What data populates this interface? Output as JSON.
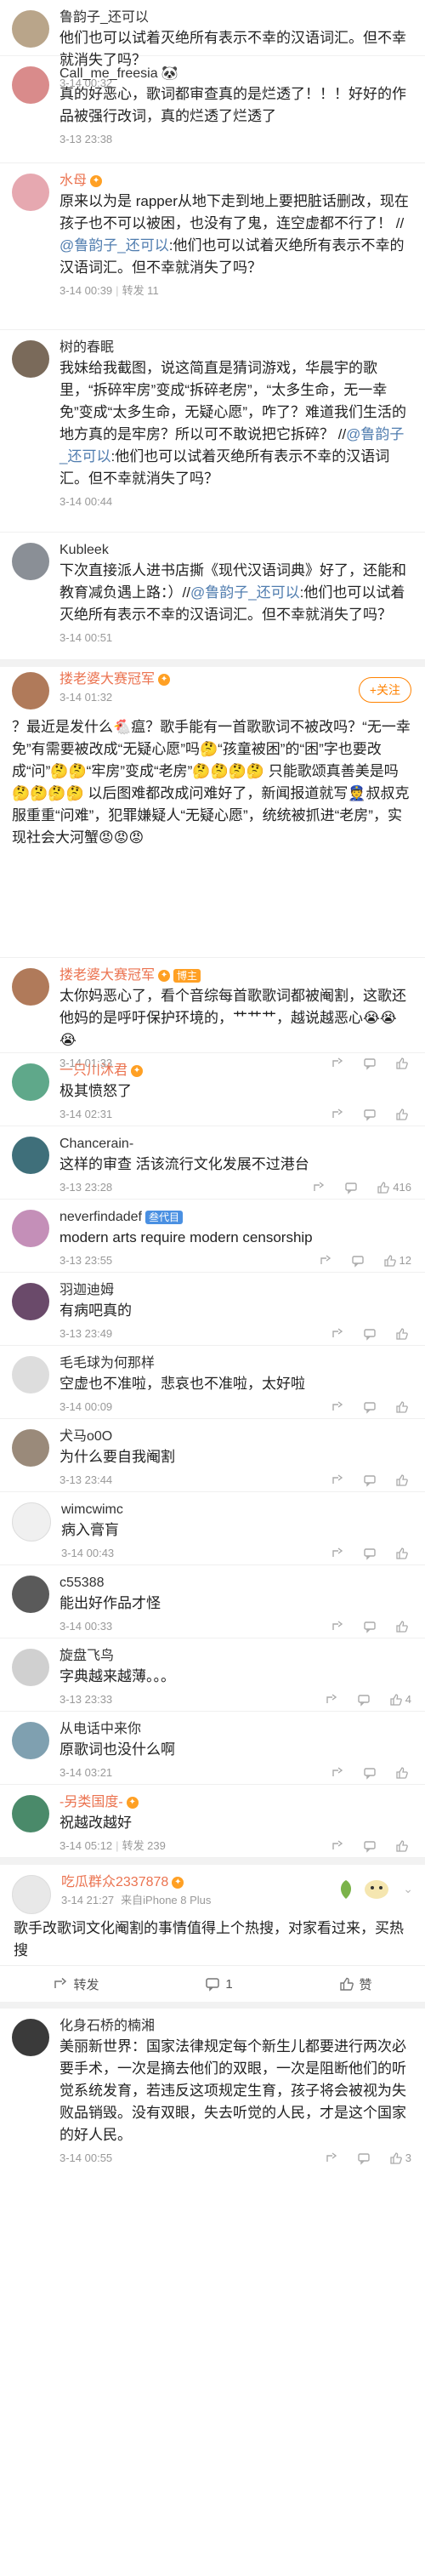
{
  "comments": [
    {
      "name": "鲁韵子_还可以",
      "text": "他们也可以试着灭绝所有表示不幸的汉语词汇。但不幸就消失了吗？",
      "meta": "3-14 00:32",
      "avatar_color": "#b9a58a"
    },
    {
      "name": "Call_me_freesia",
      "text": "真的好恶心，歌词都审查真的是烂透了！！！好好的作品被强行改词，真的烂透了烂透了",
      "meta": "3-13 23:38",
      "avatar_color": "#d98b8b"
    },
    {
      "name": "水母",
      "text_parts": [
        "原来以为是 rapper从地下走到地上要把脏话删改，现在孩子也不可以被困，也没有了鬼，连空虚都不行了！ //",
        "@鲁韵子_还可以",
        ":他们也可以试着灭绝所有表示不幸的汉语词汇。但不幸就消失了吗？"
      ],
      "meta": "3-14 00:39",
      "repost": "转发 11",
      "avatar_color": "#e6a8b0"
    },
    {
      "name": "树的春眠",
      "text_parts": [
        "我妹给我截图，说这简直是猜词游戏，华晨宇的歌里，“拆碎牢房”变成“拆碎老房”，“太多生命，无一幸免”变成“太多生命，无疑心愿”，咋了？难道我们生活的地方真的是牢房？所以可不敢说把它拆碎？ //",
        "@鲁韵子_还可以",
        ":他们也可以试着灭绝所有表示不幸的汉语词汇。但不幸就消失了吗？"
      ],
      "meta": "3-14 00:44",
      "avatar_color": "#7a6a5a"
    },
    {
      "name": "Kubleek",
      "text_parts": [
        "下次直接派人进书店撕《现代汉语词典》好了，还能和教育减负遇上路：）//",
        "@鲁韵子_还可以",
        ":他们也可以试着灭绝所有表示不幸的汉语词汇。但不幸就消失了吗？"
      ],
      "meta": "3-14 00:51",
      "avatar_color": "#8a8f96"
    }
  ],
  "featured": {
    "name": "搂老婆大赛冠军",
    "follow_label": "+关注",
    "meta": "3-14 01:32",
    "text": "？最近是发什么🐔瘟？歌手能有一首歌歌词不被改吗？“无一幸免”有需要被改成“无疑心愿”吗🤔“孩童被困”的“困”字也要改成“问”🤔🤔“牢房”变成“老房”🤔🤔🤔🤔 只能歌颂真善美是吗🤔🤔🤔🤔 以后图难都改成问难好了，新闻报道就写👮叔叔克服重重“问难”，犯罪嫌疑人“无疑心愿”，统统被抓进“老房”，实现社会大河蟹😡😡😡",
    "avatar_color": "#b07a5a"
  },
  "replies": [
    {
      "name": "搂老婆大赛冠军",
      "name_orange": true,
      "badge": "博主",
      "text": "太你妈恶心了，看个音综每首歌歌词都被阉割，这歌还他妈的是呼吁保护环境的，艹艹艹，越说越恶心😭😭😭",
      "meta": "3-14 01:33",
      "likes": "",
      "avatar_color": "#b07a5a"
    },
    {
      "name": "一只川沐君",
      "name_orange": true,
      "text": "极其愤怒了",
      "meta": "3-14 02:31",
      "likes": "",
      "avatar_color": "#5fa88a"
    },
    {
      "name": "Chancerain-",
      "text": "这样的审查 活该流行文化发展不过港台",
      "meta": "3-13 23:28",
      "likes": "416",
      "avatar_color": "#3f6f7a"
    },
    {
      "name": "neverfindadef",
      "badge": "叁代目",
      "badge_blue": true,
      "text": "modern arts require modern censorship",
      "meta": "3-13 23:55",
      "likes": "12",
      "avatar_color": "#c48fb8"
    },
    {
      "name": "羽迦迪姆",
      "text": "有病吧真的",
      "meta": "3-13 23:49",
      "likes": "",
      "avatar_color": "#6a4a6a"
    },
    {
      "name": "毛毛球为何那样",
      "text": "空虚也不准啦，悲哀也不准啦，太好啦",
      "meta": "3-14 00:09",
      "likes": "",
      "avatar_color": "#dddddd"
    },
    {
      "name": "犬马o0O",
      "text": "为什么要自我阉割",
      "meta": "3-13 23:44",
      "likes": "",
      "avatar_color": "#9a8a7a"
    },
    {
      "name": "wimcwimc",
      "text": "病入膏肓",
      "meta": "3-14 00:43",
      "likes": "",
      "avatar_color": "#f0f0f0"
    },
    {
      "name": "c55388",
      "text": "能出好作品才怪",
      "meta": "3-14 00:33",
      "likes": "",
      "avatar_color": "#5a5a5a"
    },
    {
      "name": "旋盘飞鸟",
      "text": "字典越来越薄。。。",
      "meta": "3-13 23:33",
      "likes": "4",
      "avatar_color": "#d0d0d0"
    },
    {
      "name": "从电话中来你",
      "text": "原歌词也没什么啊",
      "meta": "3-14 03:21",
      "likes": "",
      "avatar_color": "#7fa0b0"
    },
    {
      "name": "-另类国度-",
      "name_orange": true,
      "text": "祝越改越好",
      "meta": "3-14 05:12",
      "repost": "转发 239",
      "likes": "",
      "avatar_color": "#4a8a6a"
    }
  ],
  "chigua": {
    "name": "吃瓜群众2337878",
    "text": "歌手改歌词文化阉割的事情值得上个热搜，对家看过来，买热搜",
    "meta": "3-14 21:27",
    "device": "来自iPhone 8 Plus",
    "avatar_color": "#e8e8e8",
    "bar": {
      "repost": "转发",
      "comment": "1",
      "like": "赞"
    }
  },
  "last": {
    "name": "化身石桥的楠湘",
    "text": "美丽新世界：国家法律规定每个新生儿都要进行两次必要手术，一次是摘去他们的双眼，一次是阻断他们的听觉系统发育，若违反这项规定生育，孩子将会被视为失败品销毁。没有双眼，失去听觉的人民，才是这个国家的好人民。",
    "meta": "3-14 00:55",
    "likes": "3",
    "avatar_color": "#3a3a3a"
  }
}
